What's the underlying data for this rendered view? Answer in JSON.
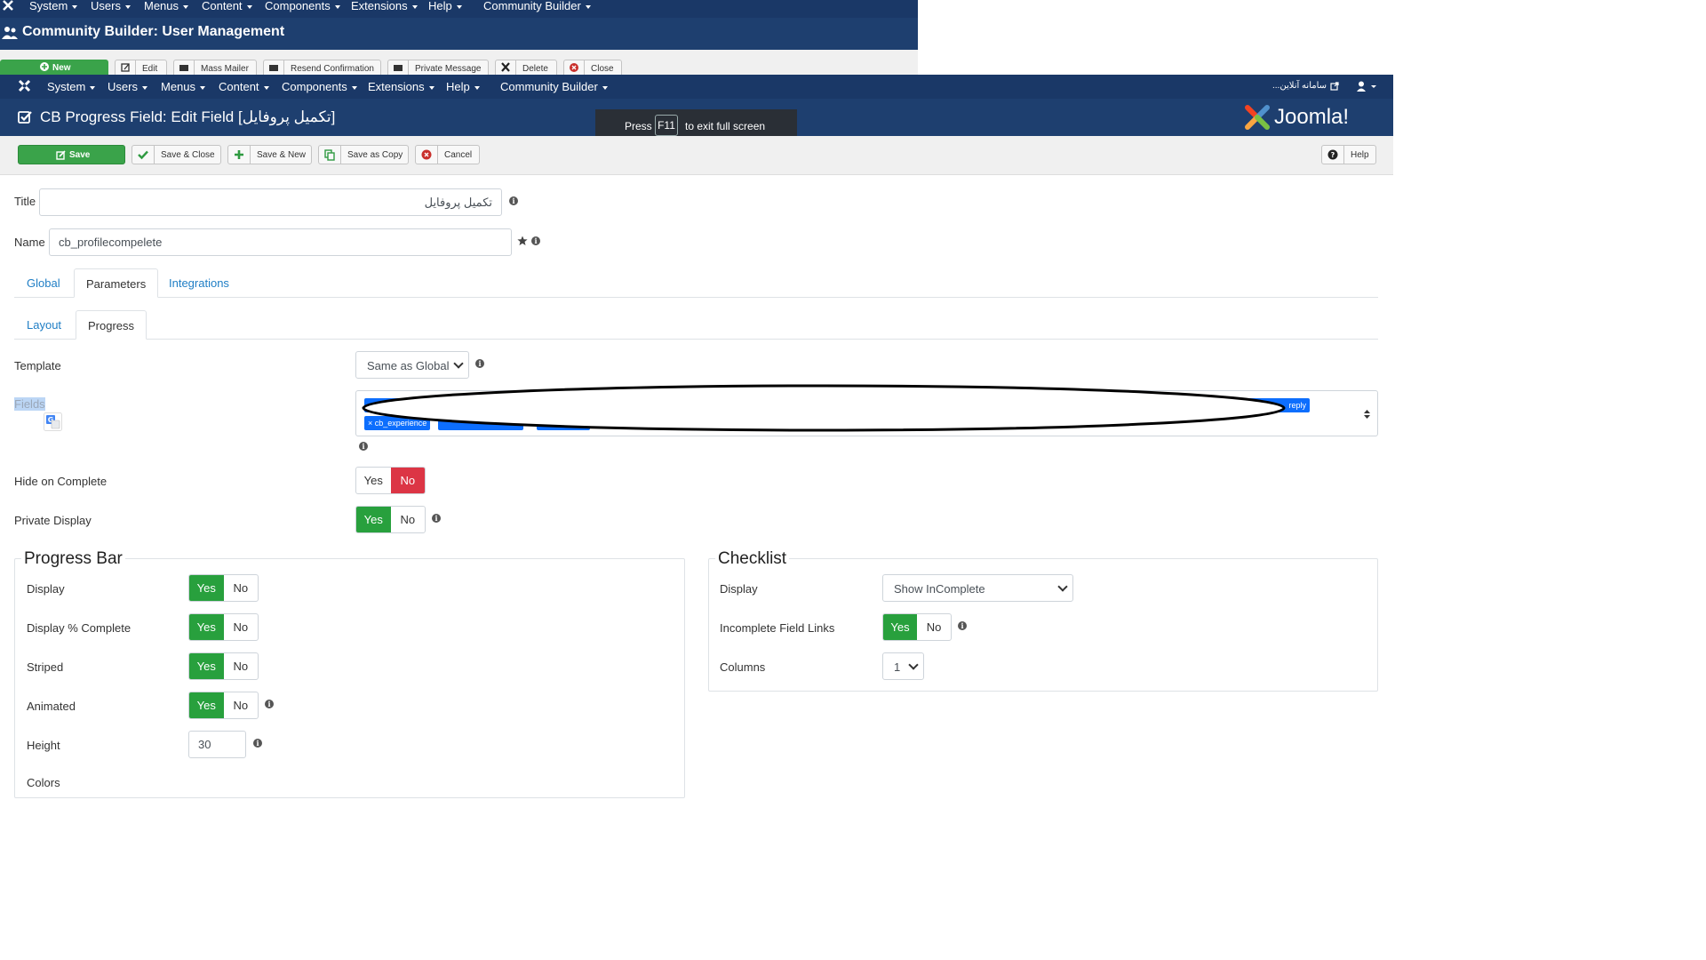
{
  "background_window": {
    "nav": [
      "System",
      "Users",
      "Menus",
      "Content",
      "Components",
      "Extensions",
      "Help",
      "Community Builder"
    ],
    "title": "Community Builder: User Management",
    "toolbar": [
      "New",
      "Edit",
      "Mass Mailer",
      "Resend Confirmation",
      "Private Message",
      "Delete",
      "Close"
    ]
  },
  "nav": {
    "items": [
      "System",
      "Users",
      "Menus",
      "Content",
      "Components",
      "Extensions",
      "Help",
      "Community Builder"
    ],
    "site_link": "...سامانه آنلاین"
  },
  "header": {
    "title": "CB Progress Field: Edit Field [تکمیل پروفایل]",
    "logo_text": "Joomla!"
  },
  "fullscreen_toast": {
    "press": "Press",
    "key": "F11",
    "rest": "to exit full screen"
  },
  "toolbar": {
    "save": "Save",
    "save_close": "Save & Close",
    "save_new": "Save & New",
    "save_copy": "Save as Copy",
    "cancel": "Cancel",
    "help": "Help"
  },
  "form": {
    "title_label": "Title",
    "title_value": "تکمیل پروفایل",
    "name_label": "Name",
    "name_value": "cb_profilecompelete",
    "tabs": [
      "Global",
      "Parameters",
      "Integrations"
    ],
    "subtabs": [
      "Layout",
      "Progress"
    ],
    "template_label": "Template",
    "template_value": "Same as Global",
    "fields_label": "Fields",
    "field_tags": [
      "cb_experience",
      "reply"
    ],
    "hide_complete_label": "Hide on Complete",
    "private_display_label": "Private Display",
    "yes": "Yes",
    "no": "No"
  },
  "progress_bar": {
    "legend": "Progress Bar",
    "display_label": "Display",
    "display_pct_label": "Display % Complete",
    "striped_label": "Striped",
    "animated_label": "Animated",
    "height_label": "Height",
    "height_value": "30",
    "colors_label": "Colors"
  },
  "checklist": {
    "legend": "Checklist",
    "display_label": "Display",
    "display_value": "Show InComplete",
    "incomplete_links_label": "Incomplete Field Links",
    "columns_label": "Columns",
    "columns_value": "1"
  },
  "colors": {
    "nav_bg": "#1a3867",
    "header_bg": "#1e3f6f",
    "success": "#28a03d",
    "danger": "#dc3545",
    "link": "#1f7ec5",
    "tag": "#0d6efd"
  }
}
